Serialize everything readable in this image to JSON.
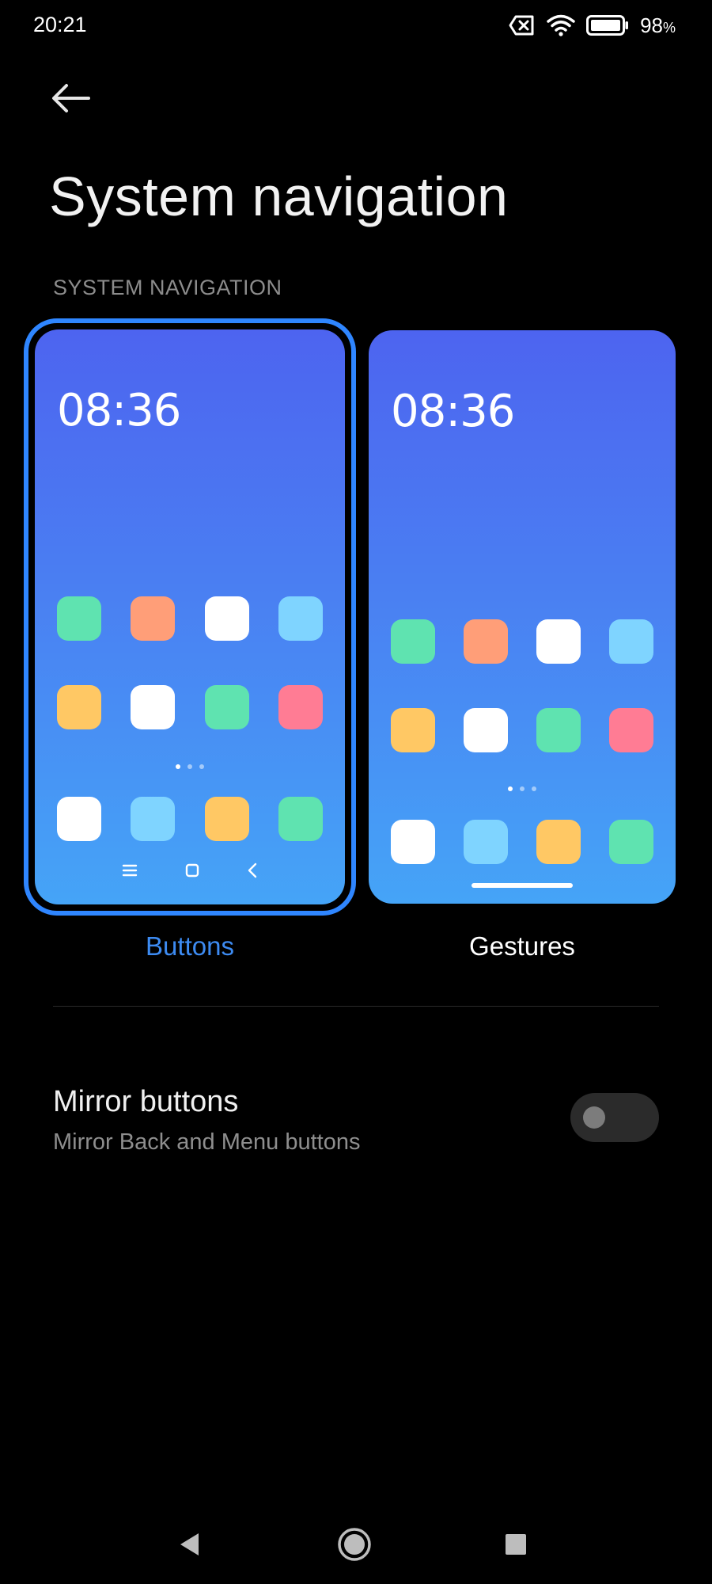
{
  "status_bar": {
    "time": "20:21",
    "battery_percent": "98",
    "battery_unit": "%",
    "icons": [
      "sim-disabled-icon",
      "wifi-icon",
      "battery-icon"
    ]
  },
  "header": {
    "back_icon": "back-arrow-icon",
    "title": "System navigation"
  },
  "section": {
    "header": "SYSTEM NAVIGATION"
  },
  "options": [
    {
      "label": "Buttons",
      "selected": true,
      "preview_time": "08:36",
      "nav_style": "buttons"
    },
    {
      "label": "Gestures",
      "selected": false,
      "preview_time": "08:36",
      "nav_style": "gesture-bar"
    }
  ],
  "app_icon_colors": {
    "row1": [
      "#5fe3b0",
      "#ff9e78",
      "#ffffff",
      "#7fd4ff"
    ],
    "row2": [
      "#ffc864",
      "#ffffff",
      "#5fe3b0",
      "#ff7c94"
    ],
    "dock": [
      "#ffffff",
      "#7fd4ff",
      "#ffc864",
      "#5fe3b0"
    ]
  },
  "mirror_setting": {
    "title": "Mirror buttons",
    "subtitle": "Mirror Back and Menu buttons",
    "enabled": false
  },
  "colors": {
    "accent": "#2f86ff",
    "background": "#000000",
    "selected_label": "#3d8bf2"
  },
  "system_nav": [
    "back-triangle-icon",
    "home-circle-icon",
    "recents-square-icon"
  ]
}
